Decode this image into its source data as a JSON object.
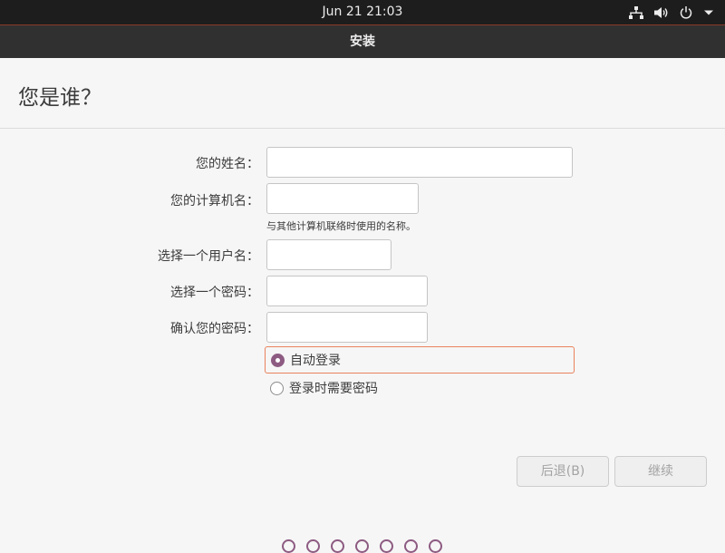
{
  "topbar": {
    "clock": "Jun 21  21:03",
    "icons": [
      "network-icon",
      "volume-icon",
      "power-icon",
      "menu-arrow-icon"
    ]
  },
  "window": {
    "title": "安装"
  },
  "page": {
    "heading": "您是谁？"
  },
  "form": {
    "name_label": "您的姓名：",
    "name_value": "",
    "computer_label": "您的计算机名：",
    "computer_value": "",
    "computer_hint": "与其他计算机联络时使用的名称。",
    "username_label": "选择一个用户名：",
    "username_value": "",
    "password_label": "选择一个密码：",
    "password_value": "",
    "confirm_label": "确认您的密码：",
    "confirm_value": "",
    "login_options": [
      {
        "label": "自动登录",
        "selected": true
      },
      {
        "label": "登录时需要密码",
        "selected": false
      }
    ]
  },
  "buttons": {
    "back": "后退(B)",
    "continue": "继续"
  },
  "progress": {
    "total_steps": 7
  },
  "colors": {
    "accent": "#8d5b82",
    "focus": "#e9825d",
    "topbar": "#1d1d1d",
    "titlebar": "#303030"
  }
}
